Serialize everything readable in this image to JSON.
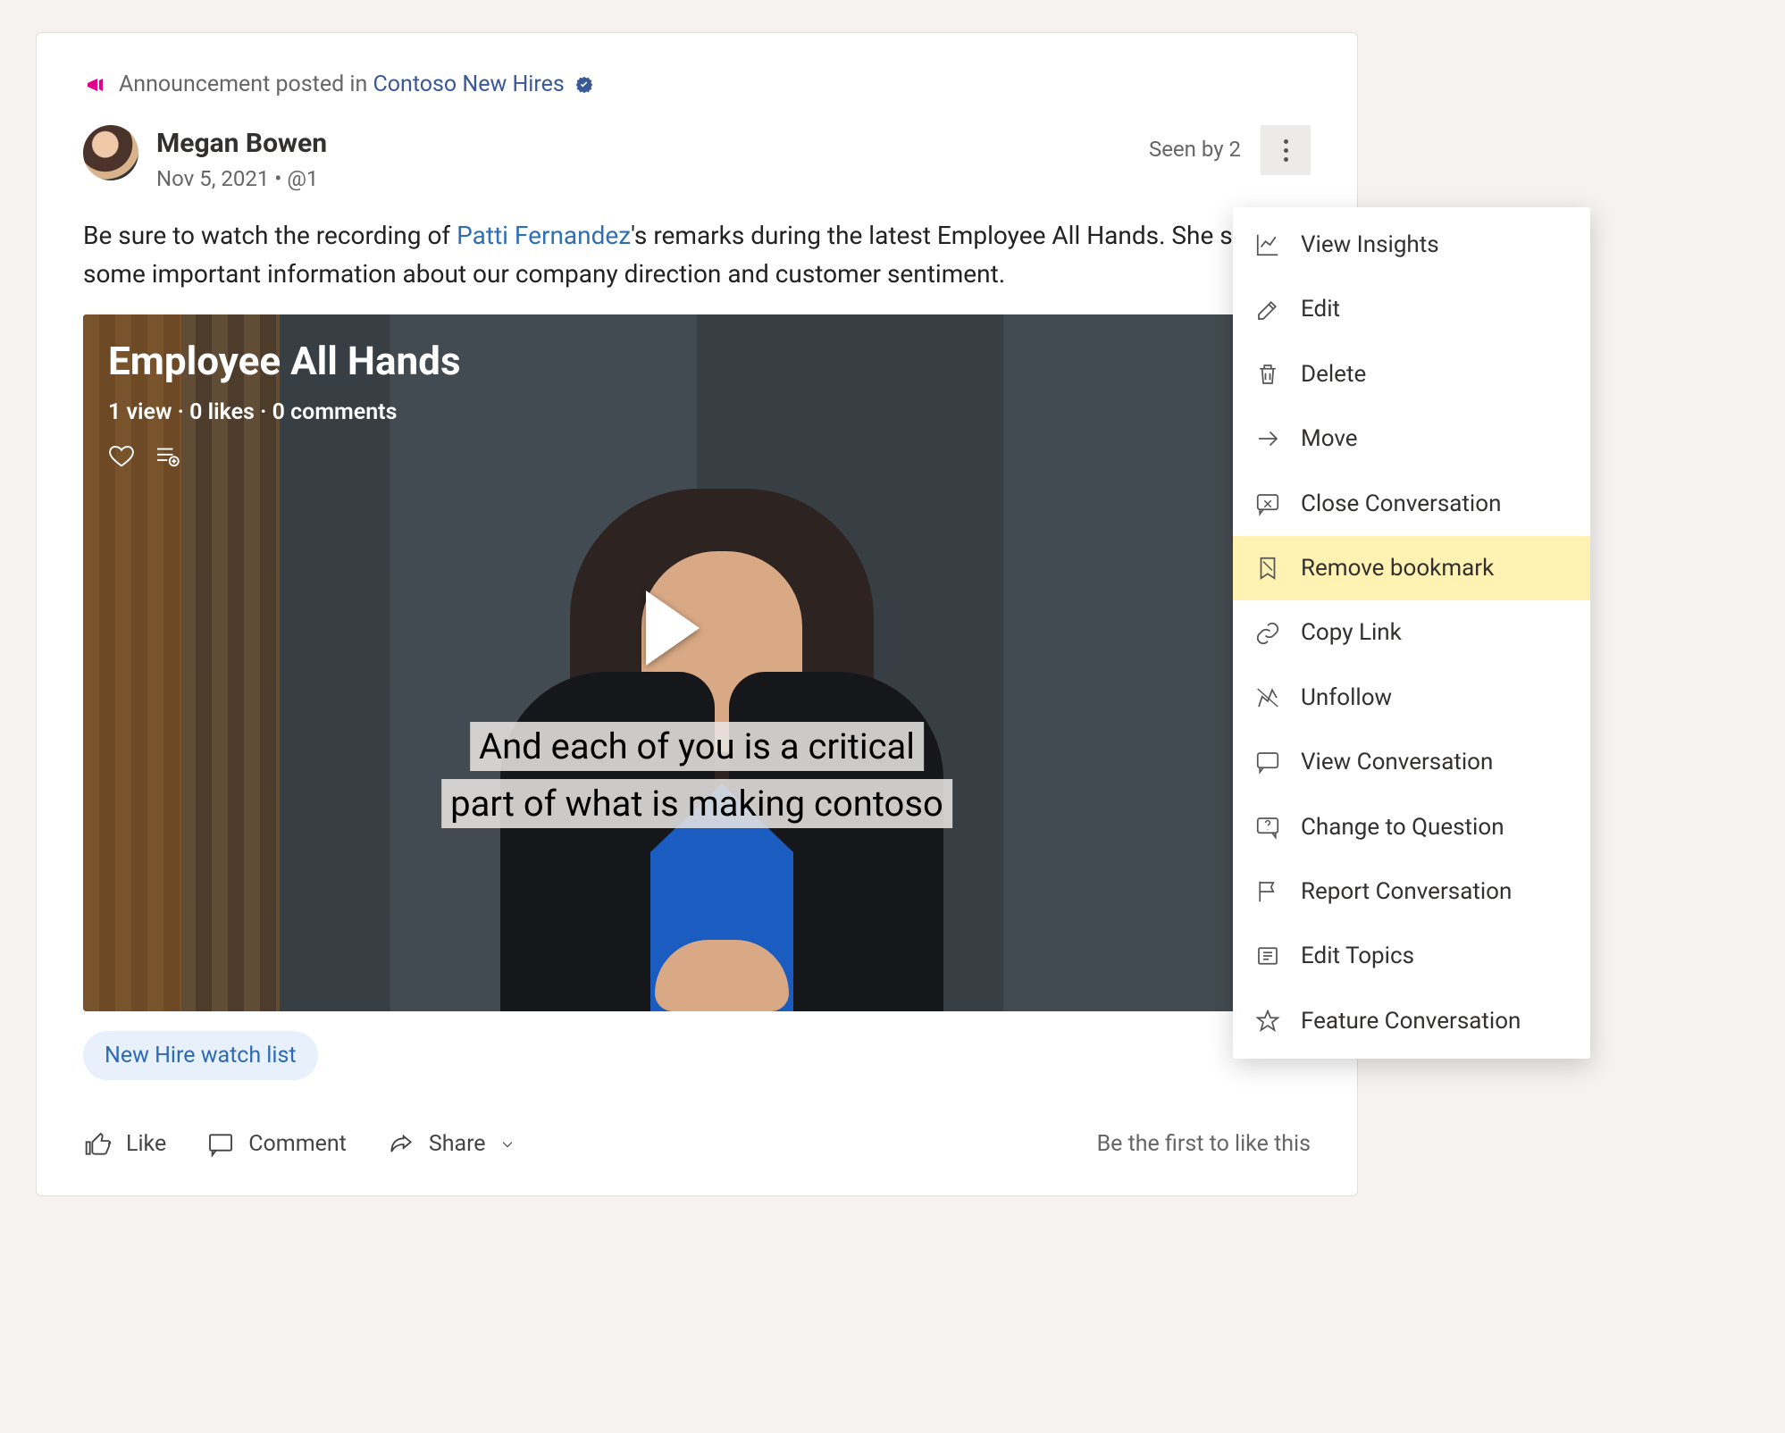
{
  "announcement": {
    "prefix": "Announcement posted in ",
    "group": "Contoso New Hires"
  },
  "author": {
    "name": "Megan Bowen",
    "date": "Nov 5, 2021",
    "separator": " • ",
    "handle": "@1"
  },
  "seen_by": "Seen by 2",
  "body": {
    "part1": "Be sure to watch the recording of ",
    "mention": "Patti Fernandez",
    "part2": "'s remarks during the latest Employee All Hands. She shares some important information about our company direction and customer sentiment."
  },
  "video": {
    "title": "Employee All Hands",
    "stats": "1 view · 0 likes · 0 comments",
    "caption_line1": "And each of you is a critical",
    "caption_line2": "part of what is making contoso"
  },
  "topic_pill": "New Hire watch list",
  "actions": {
    "like": "Like",
    "comment": "Comment",
    "share": "Share"
  },
  "like_prompt": "Be the first to like this",
  "menu": {
    "items": [
      {
        "label": "View Insights",
        "icon": "insights"
      },
      {
        "label": "Edit",
        "icon": "edit"
      },
      {
        "label": "Delete",
        "icon": "delete"
      },
      {
        "label": "Move",
        "icon": "move"
      },
      {
        "label": "Close Conversation",
        "icon": "close-convo"
      },
      {
        "label": "Remove bookmark",
        "icon": "bookmark",
        "highlight": true
      },
      {
        "label": "Copy Link",
        "icon": "copy-link"
      },
      {
        "label": "Unfollow",
        "icon": "unfollow"
      },
      {
        "label": "View Conversation",
        "icon": "view-convo"
      },
      {
        "label": "Change to Question",
        "icon": "question"
      },
      {
        "label": "Report Conversation",
        "icon": "report"
      },
      {
        "label": "Edit Topics",
        "icon": "topics"
      },
      {
        "label": "Feature Conversation",
        "icon": "feature"
      }
    ]
  }
}
